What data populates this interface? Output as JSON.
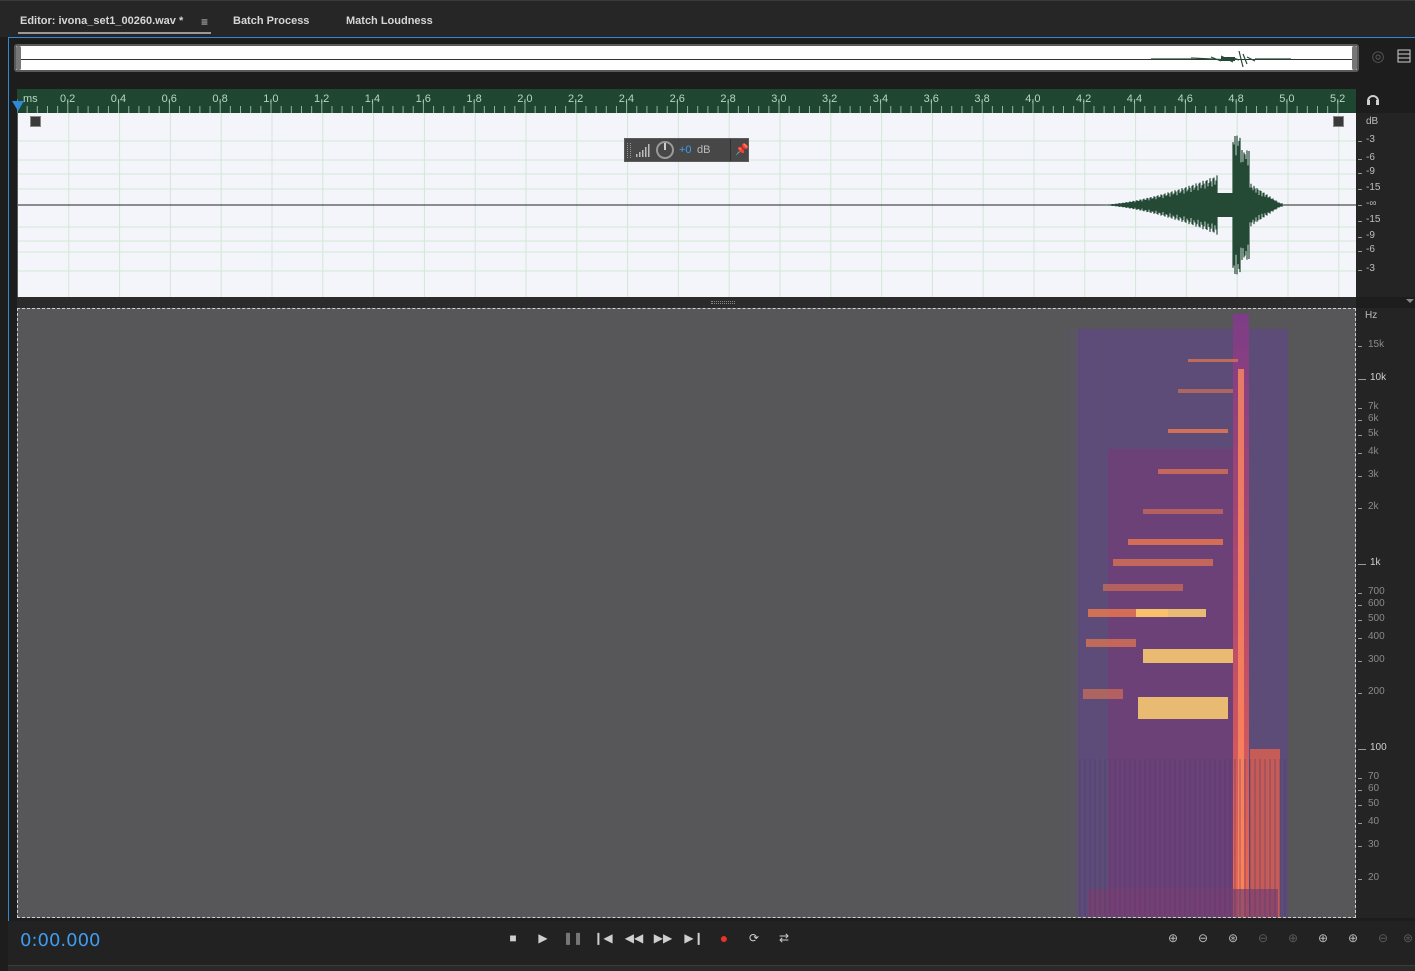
{
  "tabs": {
    "editor_label": "Editor: ivona_set1_00260.wav *",
    "editor_menu_icon": "hamburger-icon",
    "batch_label": "Batch Process",
    "match_label": "Match Loudness"
  },
  "ruler": {
    "unit": "ms",
    "labels": [
      "0,2",
      "0,4",
      "0,6",
      "0,8",
      "1,0",
      "1,2",
      "1,4",
      "1,6",
      "1,8",
      "2,0",
      "2,2",
      "2,4",
      "2,6",
      "2,8",
      "3,0",
      "3,2",
      "3,4",
      "3,6",
      "3,8",
      "4,0",
      "4,2",
      "4,4",
      "4,6",
      "4,8",
      "5,0",
      "5,2"
    ]
  },
  "hud": {
    "gain_value": "+0",
    "gain_unit": "dB"
  },
  "db_scale": {
    "unit": "dB",
    "labels": [
      "-3",
      "-6",
      "-9",
      "-15",
      "-∞",
      "-15",
      "-9",
      "-6",
      "-3"
    ]
  },
  "hz_scale": {
    "unit": "Hz",
    "labels": [
      "15k",
      "10k",
      "7k",
      "6k",
      "5k",
      "4k",
      "3k",
      "2k",
      "1k",
      "700",
      "600",
      "500",
      "400",
      "300",
      "200",
      "100",
      "70",
      "60",
      "50",
      "40",
      "30",
      "20"
    ]
  },
  "transport": {
    "time": "0:00.000",
    "buttons": [
      "stop-icon",
      "play-icon",
      "pause-icon",
      "skip-to-start-icon",
      "rewind-icon",
      "fast-forward-icon",
      "skip-to-end-icon",
      "record-icon",
      "loop-icon",
      "skip-selection-icon"
    ]
  },
  "zoom_tools": [
    "zoom-in-amplitude-icon",
    "zoom-out-amplitude-icon",
    "zoom-to-fit-icon",
    "zoom-in-left-icon",
    "zoom-in-right-icon",
    "zoom-out-full-icon",
    "zoom-in-time-icon",
    "zoom-out-time-icon",
    "zoom-full-time-icon"
  ],
  "colors": {
    "accent": "#2e8ad6",
    "time_display": "#3e9cf0",
    "ruler_bg": "#1f4630",
    "waveform": "#244a36",
    "record": "#e8322e"
  }
}
